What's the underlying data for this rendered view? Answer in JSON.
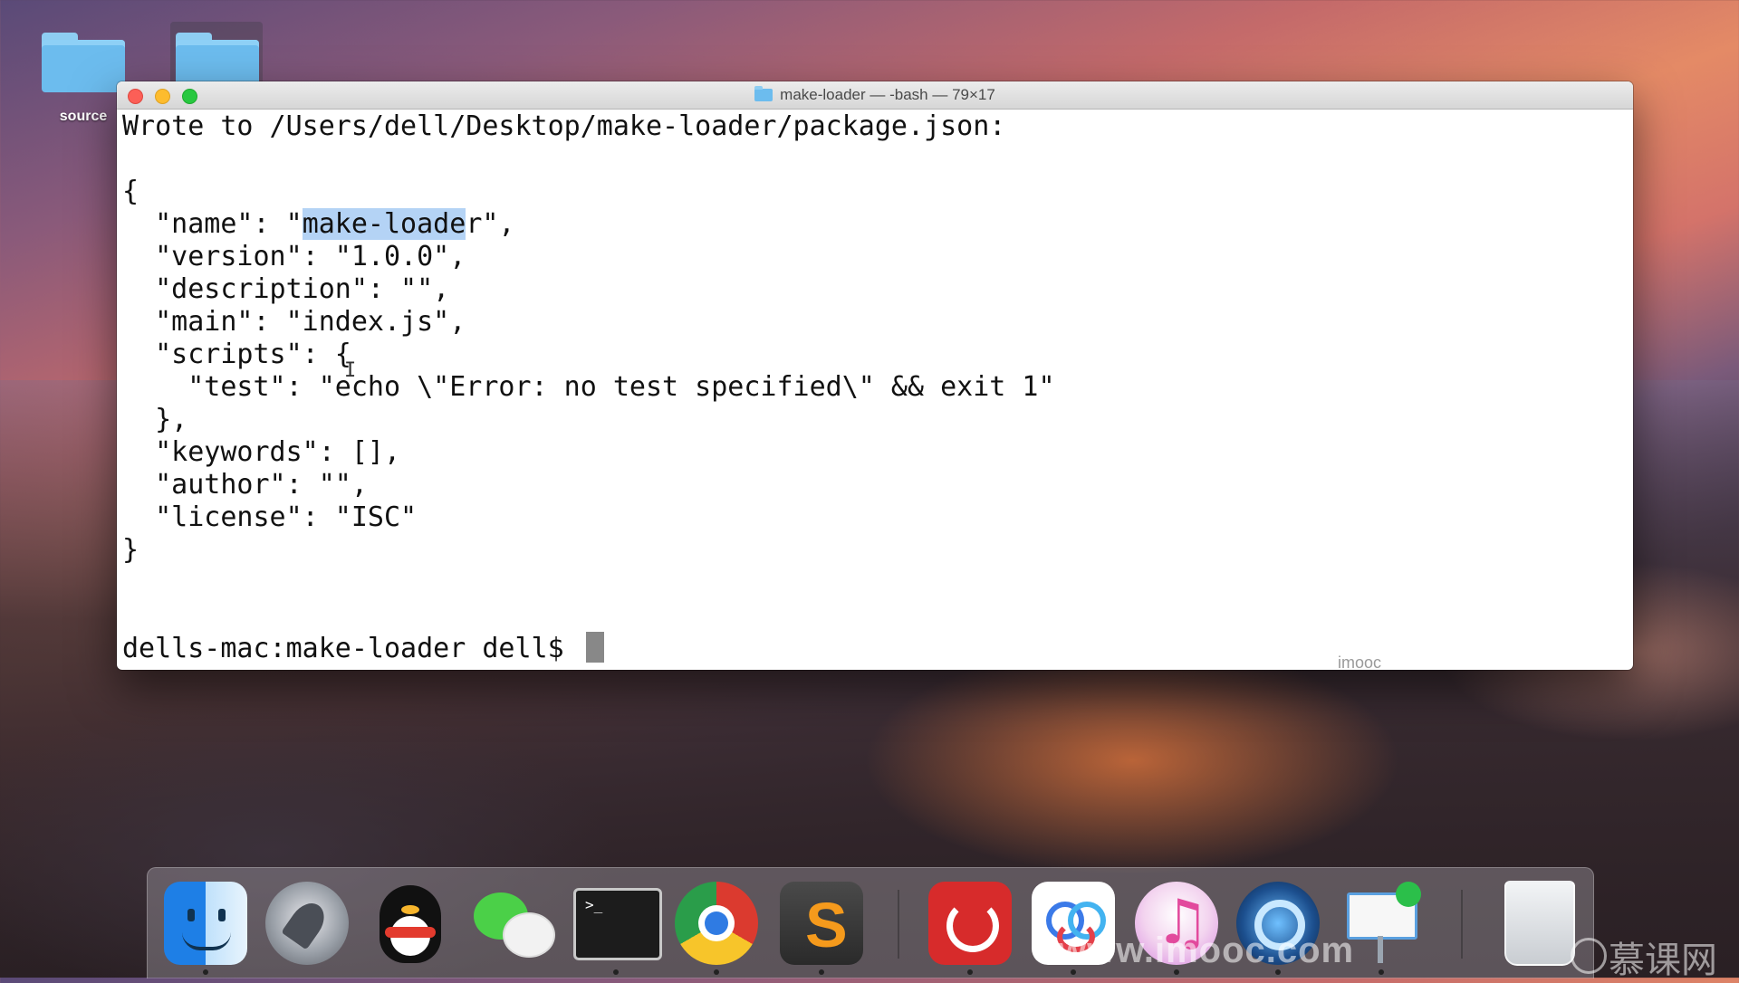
{
  "desktop": {
    "folders": [
      {
        "label": "source"
      },
      {
        "label": ""
      }
    ]
  },
  "terminal": {
    "title": "make-loader — -bash — 79×17",
    "lines": [
      "Wrote to /Users/dell/Desktop/make-loader/package.json:",
      "",
      "{",
      "  \"name\": \"make-loader\",",
      "  \"version\": \"1.0.0\",",
      "  \"description\": \"\",",
      "  \"main\": \"index.js\",",
      "  \"scripts\": {",
      "    \"test\": \"echo \\\"Error: no test specified\\\" && exit 1\"",
      "  },",
      "  \"keywords\": [],",
      "  \"author\": \"\",",
      "  \"license\": \"ISC\"",
      "}"
    ],
    "name_line": {
      "prefix": "  \"name\": \"",
      "highlighted": "make-loade",
      "suffix": "r\","
    },
    "prompt": "dells-mac:make-loader dell$ ",
    "watermark": "imooc"
  },
  "dock": {
    "items": [
      {
        "name": "finder-icon",
        "running": true
      },
      {
        "name": "launchpad-icon",
        "running": false
      },
      {
        "name": "qq-icon",
        "running": false
      },
      {
        "name": "wechat-icon",
        "running": false
      },
      {
        "name": "terminal-icon",
        "running": true,
        "glyph": ">_"
      },
      {
        "name": "chrome-icon",
        "running": true
      },
      {
        "name": "sublime-text-icon",
        "running": true,
        "glyph": "S"
      },
      {
        "name": "netease-music-icon",
        "running": true
      },
      {
        "name": "baidu-netdisk-icon",
        "running": true
      },
      {
        "name": "itunes-icon",
        "running": true,
        "glyph": "♫"
      },
      {
        "name": "quicktime-icon",
        "running": true
      },
      {
        "name": "keynote-icon",
        "running": true
      },
      {
        "name": "trash-icon",
        "running": false
      }
    ]
  },
  "site_watermark": {
    "url": "www.imooc.com",
    "cn": "慕课网"
  },
  "colors": {
    "selection": "#b4d3f5",
    "close": "#fc5f57",
    "minimize": "#fdbc2e",
    "maximize": "#28c840"
  }
}
